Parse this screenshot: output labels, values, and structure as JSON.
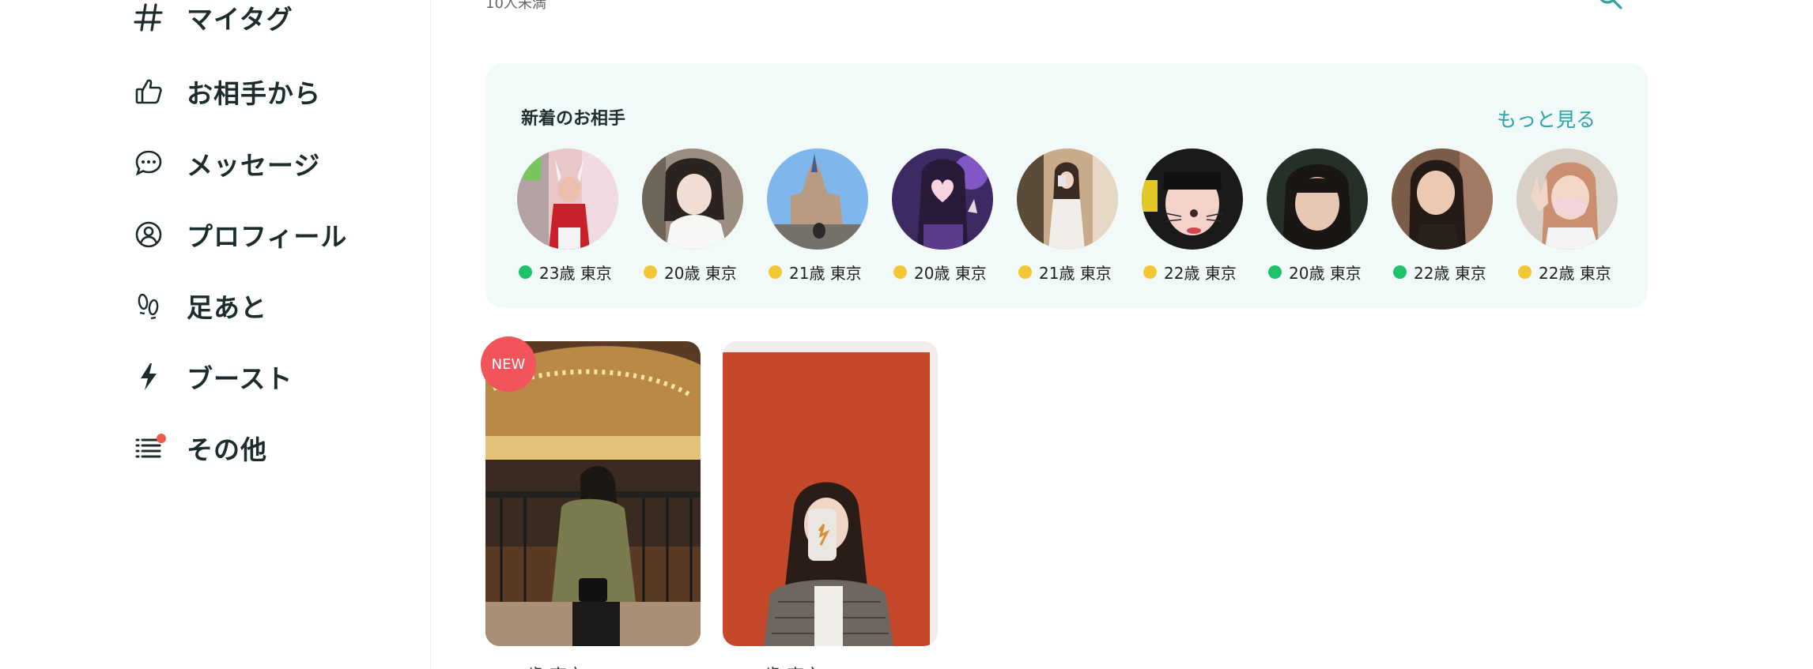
{
  "sidebar": {
    "items": [
      {
        "label": "マイタグ",
        "icon": "hash-icon"
      },
      {
        "label": "お相手から",
        "icon": "thumbs-up-icon"
      },
      {
        "label": "メッセージ",
        "icon": "chat-bubble-icon"
      },
      {
        "label": "プロフィール",
        "icon": "user-circle-icon"
      },
      {
        "label": "足あと",
        "icon": "footprints-icon"
      },
      {
        "label": "ブースト",
        "icon": "lightning-icon"
      },
      {
        "label": "その他",
        "icon": "list-icon",
        "badge": true
      }
    ]
  },
  "search": {
    "filter_text": "10人未満",
    "icon": "search-icon"
  },
  "newcomers": {
    "title": "新着のお相手",
    "more_label": "もっと見る",
    "profiles": [
      {
        "age": "23歳",
        "location": "東京",
        "status": "online"
      },
      {
        "age": "20歳",
        "location": "東京",
        "status": "recent"
      },
      {
        "age": "21歳",
        "location": "東京",
        "status": "recent"
      },
      {
        "age": "20歳",
        "location": "東京",
        "status": "recent"
      },
      {
        "age": "21歳",
        "location": "東京",
        "status": "recent"
      },
      {
        "age": "22歳",
        "location": "東京",
        "status": "recent"
      },
      {
        "age": "20歳",
        "location": "東京",
        "status": "online"
      },
      {
        "age": "22歳",
        "location": "東京",
        "status": "online"
      },
      {
        "age": "22歳",
        "location": "東京",
        "status": "recent"
      }
    ]
  },
  "cards": [
    {
      "badge": "NEW",
      "caption": "歳 東京"
    },
    {
      "badge": "",
      "caption": "歳 東京"
    }
  ],
  "colors": {
    "online": "#1ec26a",
    "recent": "#f1c734",
    "accent": "#2fa3a4",
    "new_badge": "#f2545b",
    "panel_bg": "#f1faf8"
  }
}
